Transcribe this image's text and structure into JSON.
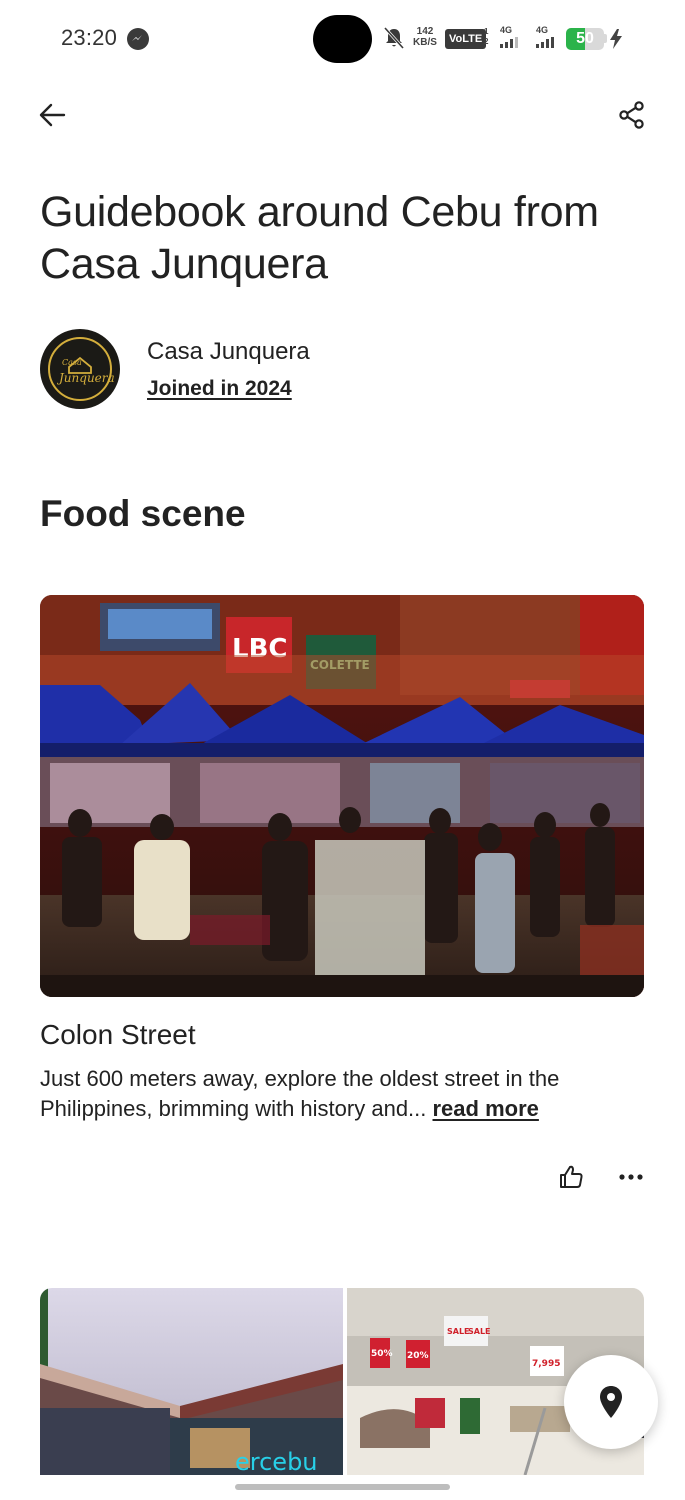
{
  "status_bar": {
    "time": "23:20",
    "speed_value": "142",
    "speed_unit": "KB/S",
    "volte": "VoLTE",
    "sim_index_top": "1",
    "sim_index_bottom": "2",
    "network_1": "4G",
    "network_2": "4G",
    "battery": "50",
    "icons": [
      "messenger-icon",
      "bell-off-icon",
      "signal-icon",
      "charging-icon"
    ]
  },
  "header": {
    "back_icon": "arrow-left-icon",
    "share_icon": "share-icon"
  },
  "guidebook": {
    "title": "Guidebook around Cebu from Casa Junquera"
  },
  "host": {
    "name": "Casa Junquera",
    "joined": "Joined in 2024",
    "logo_text_top": "Casa",
    "logo_text_bottom": "Junquera"
  },
  "section": {
    "heading": "Food scene"
  },
  "place": {
    "name": "Colon Street",
    "description": "Just 600 meters away, explore the oldest street in the Philippines, brimming with history and... ",
    "read_more": "read more",
    "image_signs": [
      "LBC",
      "COLETTE"
    ],
    "like_icon": "thumbs-up-icon",
    "more_icon": "more-horizontal-icon"
  },
  "second_card": {
    "mall_sign": "ercebu",
    "sale_tags": [
      "SALE",
      "SALE",
      "50%",
      "20%",
      "7,995"
    ]
  },
  "map_button": {
    "icon": "map-pin-icon"
  },
  "colors": {
    "text": "#222222",
    "battery_green": "#2bb34a",
    "tent_blue": "#1f2fa8"
  }
}
